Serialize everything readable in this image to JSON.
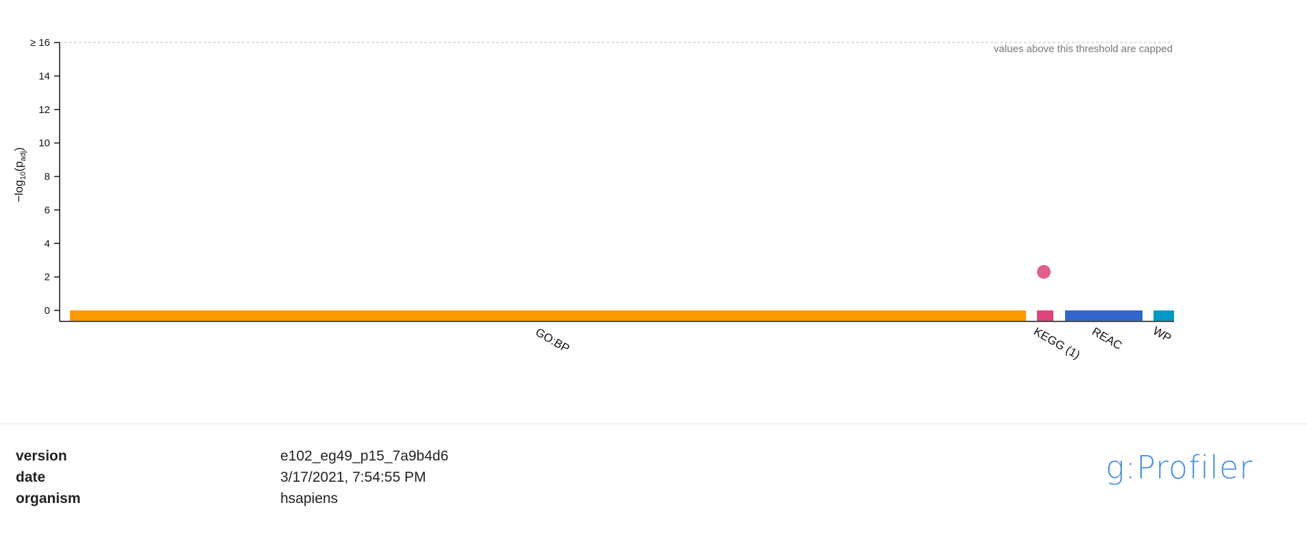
{
  "chart_data": {
    "type": "scatter",
    "ylabel": "−log₁₀(p_adj)",
    "ylim": [
      0,
      16
    ],
    "yticks": [
      "0",
      "2",
      "4",
      "6",
      "8",
      "10",
      "12",
      "14",
      "≥ 16"
    ],
    "cap_note": "values above this threshold are capped",
    "categories": [
      {
        "label": "GO:BP",
        "color": "#ff9900"
      },
      {
        "label": "KEGG (1)",
        "color": "#dd4477"
      },
      {
        "label": "REAC",
        "color": "#3366cc"
      },
      {
        "label": "WP",
        "color": "#0099c6"
      }
    ],
    "points": [
      {
        "category": "KEGG (1)",
        "y": 2.3,
        "color": "#e0608a"
      }
    ],
    "grid": false
  },
  "meta": {
    "rows": [
      {
        "key": "version",
        "value": "e102_eg49_p15_7a9b4d6"
      },
      {
        "key": "date",
        "value": "3/17/2021, 7:54:55 PM"
      },
      {
        "key": "organism",
        "value": "hsapiens"
      }
    ]
  },
  "logo": "g:Profiler"
}
